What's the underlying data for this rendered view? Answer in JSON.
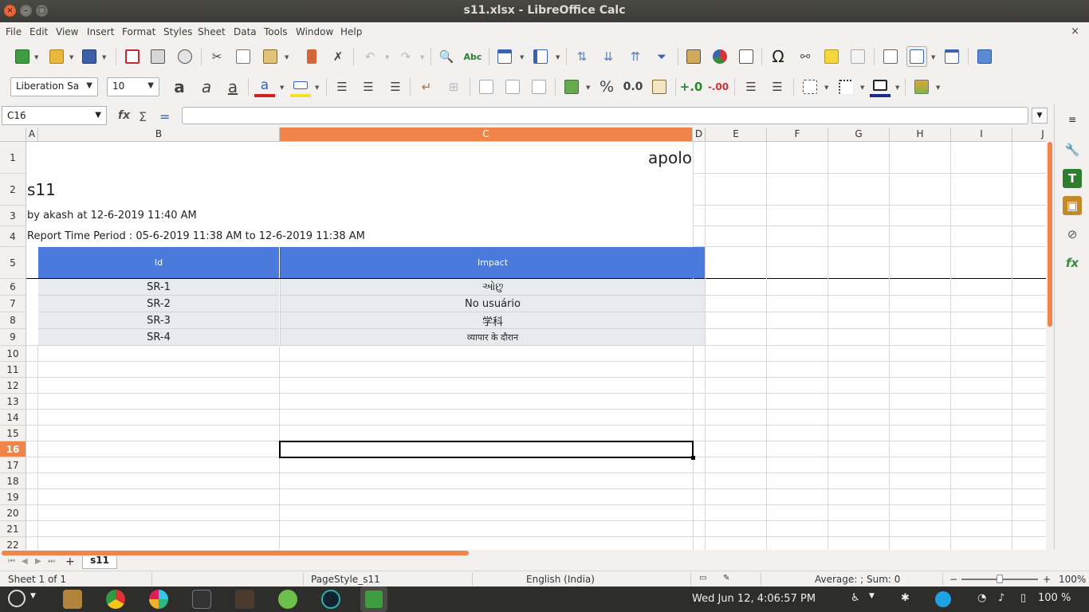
{
  "window": {
    "title": "s11.xlsx - LibreOffice Calc",
    "close_glyph": "×",
    "min_glyph": "–",
    "max_glyph": "□"
  },
  "menu": [
    "File",
    "Edit",
    "View",
    "Insert",
    "Format",
    "Styles",
    "Sheet",
    "Data",
    "Tools",
    "Window",
    "Help"
  ],
  "menu_close": "×",
  "formatting": {
    "font_name": "Liberation Sa",
    "font_size": "10",
    "percent_label": "%",
    "decimal_label": "0.0"
  },
  "formula_bar": {
    "cell_ref": "C16",
    "formula": ""
  },
  "columns": [
    "A",
    "B",
    "C",
    "D",
    "E",
    "F",
    "G",
    "H",
    "I",
    "J"
  ],
  "rows": [
    "1",
    "2",
    "3",
    "4",
    "5",
    "6",
    "7",
    "8",
    "9",
    "10",
    "11",
    "12",
    "13",
    "14",
    "15",
    "16",
    "17",
    "18",
    "19",
    "20",
    "21",
    "22"
  ],
  "cells": {
    "c1": "apolo",
    "a2": "s11",
    "a3": "by akash at 12-6-2019 11:40 AM",
    "a4": "Report Time Period : 05-6-2019 11:38 AM to 12-6-2019 11:38 AM"
  },
  "table": {
    "headers": [
      "Id",
      "Impact"
    ],
    "rows": [
      [
        "SR-1",
        "ઓછુ"
      ],
      [
        "SR-2",
        "No usuário"
      ],
      [
        "SR-3",
        "学科"
      ],
      [
        "SR-4",
        "व्यापार के दौरान"
      ]
    ]
  },
  "sheet_tab": "s11",
  "status": {
    "sheet": "Sheet 1 of 1",
    "page_style": "PageStyle_s11",
    "language": "English (India)",
    "summary": "Average: ; Sum: 0",
    "zoom": "100%"
  },
  "taskbar": {
    "clock": "Wed Jun 12,  4:06:57 PM",
    "battery": "100 %"
  },
  "colors": {
    "selection": "#f0844b",
    "table_header": "#4a7bdc",
    "table_body": "#e7ebef"
  }
}
